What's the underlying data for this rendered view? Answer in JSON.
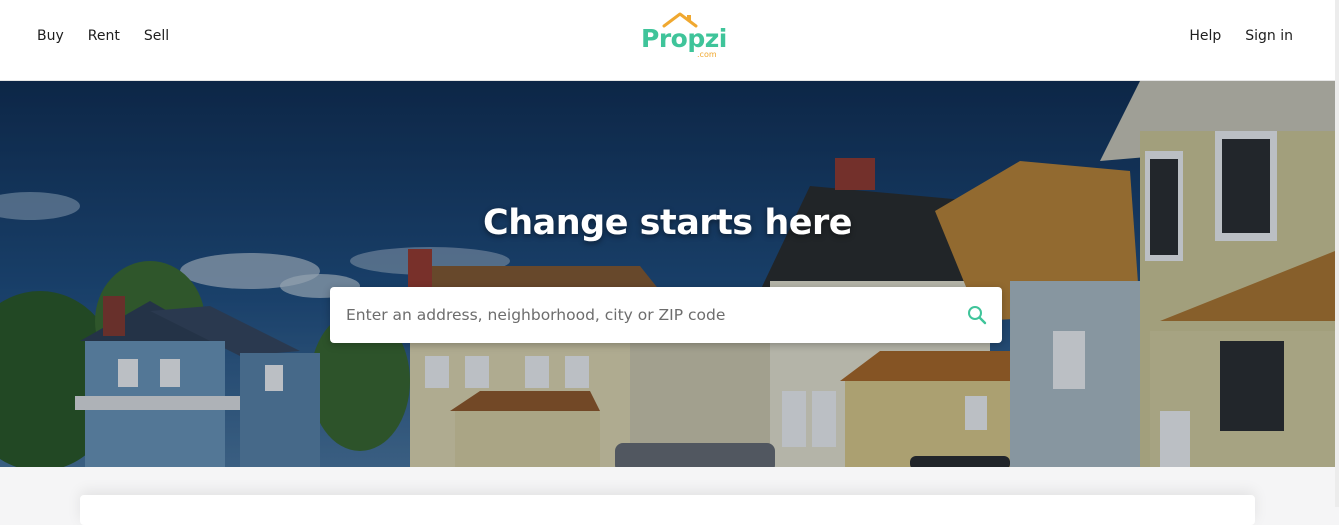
{
  "header": {
    "nav_left": [
      "Buy",
      "Rent",
      "Sell"
    ],
    "nav_right": [
      "Help",
      "Sign in"
    ],
    "logo": {
      "text": "Propzi",
      "sub": ".com"
    }
  },
  "hero": {
    "title": "Change starts here",
    "search": {
      "placeholder": "Enter an address, neighborhood, city or ZIP code",
      "value": "",
      "icon": "search-icon"
    }
  },
  "colors": {
    "brand_green": "#3fc49a",
    "brand_orange": "#f0a830",
    "text_dark": "#1e1e1e"
  }
}
